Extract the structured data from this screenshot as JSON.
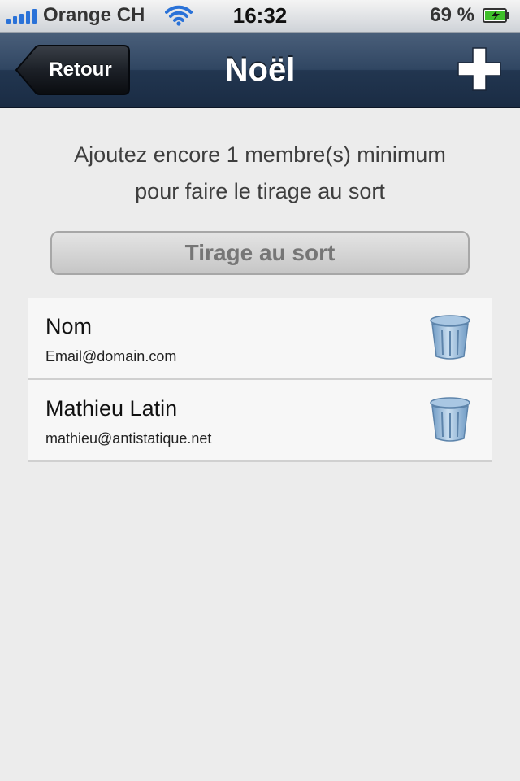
{
  "status_bar": {
    "carrier": "Orange CH",
    "time": "16:32",
    "battery_percent": "69 %",
    "signal_icon": "signal-bars-icon",
    "wifi_icon": "wifi-icon",
    "battery_icon": "battery-charging-icon"
  },
  "nav": {
    "back_label": "Retour",
    "title": "Noël",
    "add_icon": "plus-icon"
  },
  "message": {
    "line1": "Ajoutez encore 1 membre(s) minimum",
    "line2": "pour faire le tirage au sort"
  },
  "draw_button": {
    "label": "Tirage au sort",
    "enabled": false
  },
  "members": [
    {
      "name": "Nom",
      "email": "Email@domain.com"
    },
    {
      "name": "Mathieu Latin",
      "email": "mathieu@antistatique.net"
    }
  ],
  "colors": {
    "nav_bar": "#2a3f5c",
    "background": "#ececec",
    "signal": "#2a72d8",
    "battery_fill": "#3fbf2a",
    "trash": "#8fb6d8"
  }
}
